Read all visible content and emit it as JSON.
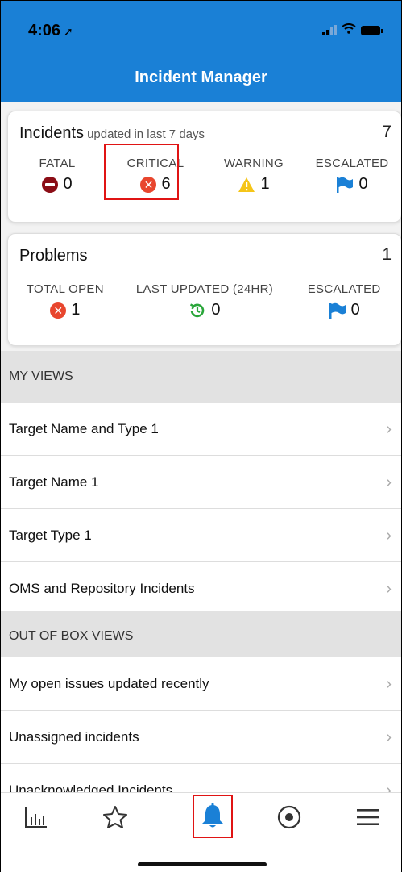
{
  "status_bar": {
    "time": "4:06",
    "location_arrow": "location-arrow-icon"
  },
  "header": {
    "title": "Incident Manager",
    "background": "#1a80d6"
  },
  "incidents_card": {
    "title": "Incidents",
    "subtitle": "updated in last 7 days",
    "count": "7",
    "metrics": [
      {
        "label": "FATAL",
        "value": "0",
        "icon": "fatal-icon"
      },
      {
        "label": "CRITICAL",
        "value": "6",
        "icon": "critical-icon"
      },
      {
        "label": "WARNING",
        "value": "1",
        "icon": "warning-icon"
      },
      {
        "label": "ESCALATED",
        "value": "0",
        "icon": "flag-icon"
      }
    ]
  },
  "problems_card": {
    "title": "Problems",
    "count": "1",
    "metrics": [
      {
        "label": "TOTAL OPEN",
        "value": "1",
        "icon": "critical-icon"
      },
      {
        "label": "LAST UPDATED (24HR)",
        "value": "0",
        "icon": "history-icon"
      },
      {
        "label": "ESCALATED",
        "value": "0",
        "icon": "flag-icon"
      }
    ]
  },
  "my_views": {
    "header": "MY VIEWS",
    "items": [
      {
        "label": "Target Name and Type 1"
      },
      {
        "label": "Target Name 1"
      },
      {
        "label": "Target Type 1"
      },
      {
        "label": "OMS and Repository Incidents"
      }
    ]
  },
  "out_of_box_views": {
    "header": "OUT OF BOX VIEWS",
    "items": [
      {
        "label": "My open issues updated recently"
      },
      {
        "label": "Unassigned incidents"
      },
      {
        "label": "Unacknowledged Incidents"
      }
    ]
  },
  "tabbar": {
    "items": [
      {
        "icon": "chart-icon"
      },
      {
        "icon": "star-icon"
      },
      {
        "icon": "bell-icon",
        "active": true
      },
      {
        "icon": "target-icon"
      },
      {
        "icon": "menu-icon"
      }
    ]
  },
  "colors": {
    "accent": "#1a80d6",
    "critical": "#e8462e",
    "fatal": "#8b0d16",
    "warning": "#f5c518",
    "ok": "#2aa63a",
    "highlight": "#e01414"
  }
}
